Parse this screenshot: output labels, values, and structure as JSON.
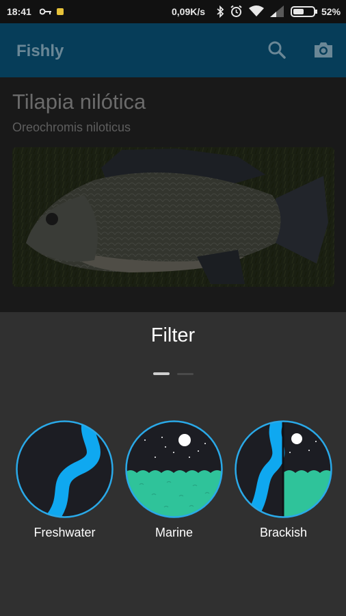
{
  "status_bar": {
    "time": "18:41",
    "network_speed": "0,09K/s",
    "battery": "52%",
    "icons": [
      "key-icon",
      "notification-icon",
      "bluetooth-icon",
      "alarm-icon",
      "wifi-icon",
      "signal-icon",
      "battery-icon"
    ]
  },
  "app_bar": {
    "title": "Fishly",
    "actions": [
      "search-icon",
      "camera-icon"
    ]
  },
  "species": {
    "common_name": "Tilapia nilótica",
    "scientific_name": "Oreochromis niloticus",
    "photo": "fish-photo"
  },
  "filter_sheet": {
    "title": "Filter",
    "page_indicator": {
      "current": 1,
      "total": 2
    },
    "options": [
      {
        "label": "Freshwater"
      },
      {
        "label": "Marine"
      },
      {
        "label": "Brackish"
      }
    ]
  },
  "colors": {
    "app_bar": "#063d59",
    "water_blue": "#0fa8f0",
    "sea_teal": "#2fc39a",
    "circle_stroke": "#2aa9e8",
    "sheet_bg": "#303030"
  }
}
